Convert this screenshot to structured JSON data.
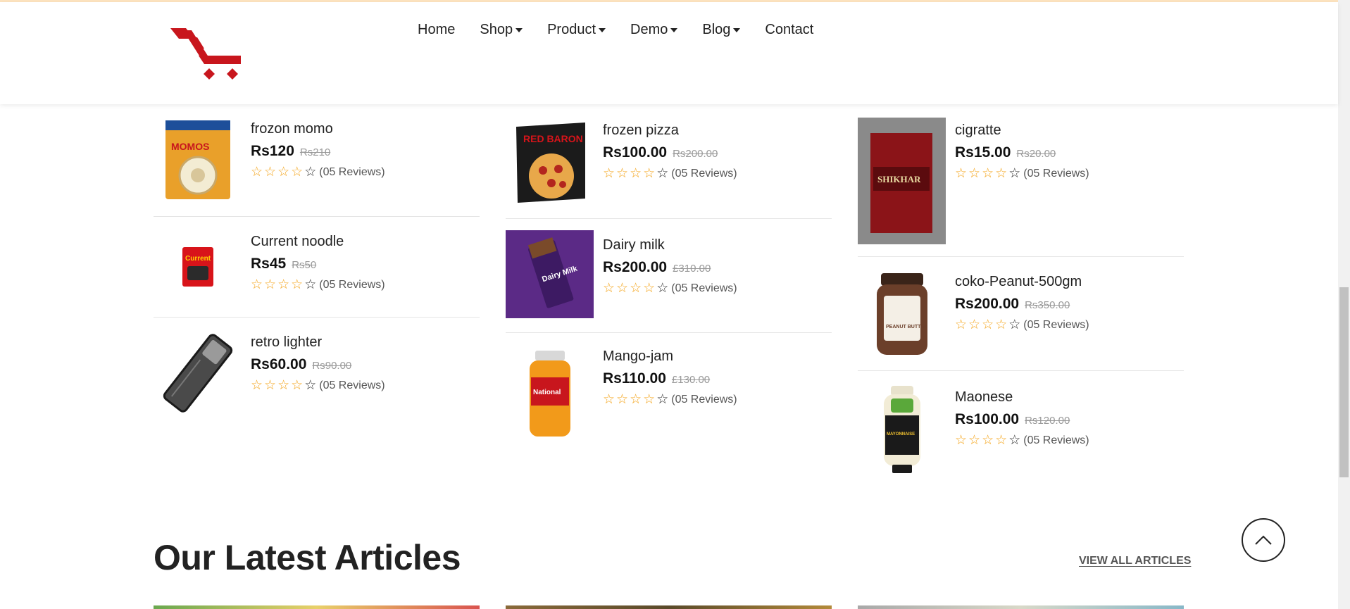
{
  "nav": {
    "items": [
      {
        "label": "Home",
        "dropdown": false
      },
      {
        "label": "Shop",
        "dropdown": true
      },
      {
        "label": "Product",
        "dropdown": true
      },
      {
        "label": "Demo",
        "dropdown": true
      },
      {
        "label": "Blog",
        "dropdown": true
      },
      {
        "label": "Contact",
        "dropdown": false
      }
    ]
  },
  "colors": {
    "brand": "#c8161d",
    "star": "#f4a51c",
    "accent_bar": "#fde3bf"
  },
  "products": {
    "columns": [
      [
        {
          "name": "frozon momo",
          "price": "Rs120",
          "old_price": "Rs210",
          "reviews": "(05 Reviews)",
          "filled_stars": 4,
          "image_icon": "momo-pack-image"
        },
        {
          "name": "Current noodle",
          "price": "Rs45",
          "old_price": "Rs50",
          "reviews": "(05 Reviews)",
          "filled_stars": 4,
          "image_icon": "noodle-pack-image"
        },
        {
          "name": "retro lighter",
          "price": "Rs60.00",
          "old_price": "Rs90.00",
          "reviews": "(05 Reviews)",
          "filled_stars": 4,
          "image_icon": "lighter-image"
        }
      ],
      [
        {
          "name": "frozen pizza",
          "price": "Rs100.00",
          "old_price": "Rs200.00",
          "reviews": "(05 Reviews)",
          "filled_stars": 4,
          "image_icon": "pizza-box-image"
        },
        {
          "name": "Dairy milk",
          "price": "Rs200.00",
          "old_price": "£310.00",
          "reviews": "(05 Reviews)",
          "filled_stars": 4,
          "image_icon": "chocolate-image"
        },
        {
          "name": "Mango-jam",
          "price": "Rs110.00",
          "old_price": "£130.00",
          "reviews": "(05 Reviews)",
          "filled_stars": 4,
          "image_icon": "jam-jar-image"
        }
      ],
      [
        {
          "name": "cigratte",
          "price": "Rs15.00",
          "old_price": "Rs20.00",
          "reviews": "(05 Reviews)",
          "filled_stars": 4,
          "image_icon": "cigarette-pack-image"
        },
        {
          "name": "coko-Peanut-500gm",
          "price": "Rs200.00",
          "old_price": "Rs350.00",
          "reviews": "(05 Reviews)",
          "filled_stars": 4,
          "image_icon": "peanut-butter-jar-image"
        },
        {
          "name": "Maonese",
          "price": "Rs100.00",
          "old_price": "Rs120.00",
          "reviews": "(05 Reviews)",
          "filled_stars": 4,
          "image_icon": "mayonnaise-bottle-image"
        }
      ]
    ]
  },
  "thumb_text": {
    "momo": "MOMOS",
    "noodle": "Current",
    "pizza": "RED BARON",
    "dairy": "Dairy Milk",
    "jam": "National",
    "cig": "SHIKHAR",
    "peanut": "PEANUT BUTTER",
    "mayo": "MAYONNAISE"
  },
  "articles": {
    "title": "Our Latest Articles",
    "view_all": "VIEW ALL ARTICLES"
  }
}
